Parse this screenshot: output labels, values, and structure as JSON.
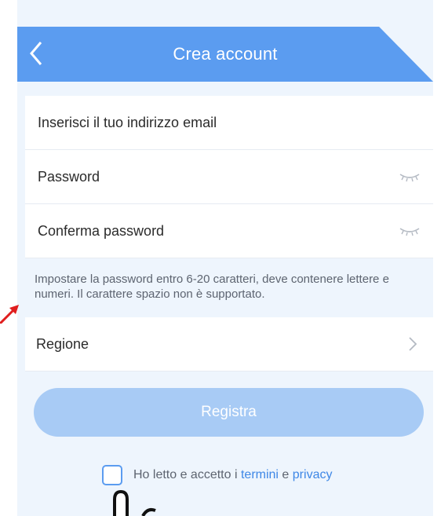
{
  "header": {
    "title": "Crea account",
    "back_icon": "chevron-left-icon",
    "color": "#5b9cf0"
  },
  "form": {
    "email_placeholder": "Inserisci il tuo indirizzo email",
    "password_placeholder": "Password",
    "confirm_placeholder": "Conferma password",
    "password_hint": "Impostare la password entro 6-20 caratteri, deve contenere lettere e numeri. Il carattere spazio non è supportato.",
    "region_label": "Regione",
    "eye_icon": "eye-closed-icon",
    "chevron_icon": "chevron-right-icon"
  },
  "register_button": {
    "label": "Registra",
    "color": "#a8cbf5"
  },
  "agreement": {
    "text_before": "Ho letto e accetto",
    "text_i": " i ",
    "terms_link": "termini",
    "text_and": " e ",
    "privacy_link": "privacy",
    "checked": false
  },
  "annotations": {
    "arrow_color": "#e01e1e"
  }
}
